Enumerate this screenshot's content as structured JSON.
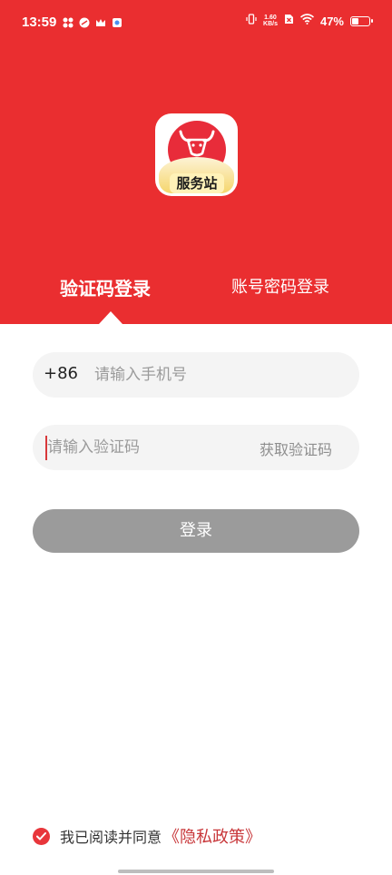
{
  "status_bar": {
    "time": "13:59",
    "net_speed_value": "1.60",
    "net_speed_unit": "KB/s",
    "battery": "47%",
    "battery_level": 0.47
  },
  "app": {
    "logo_text": "服务站"
  },
  "tabs": [
    {
      "label": "验证码登录",
      "active": true
    },
    {
      "label": "账号密码登录",
      "active": false
    }
  ],
  "form": {
    "country_code": "+86",
    "phone_placeholder": "请输入手机号",
    "code_placeholder": "请输入验证码",
    "get_code_label": "获取验证码",
    "login_label": "登录"
  },
  "agreement": {
    "text": "我已阅读并同意",
    "policy_link": "《隐私政策》",
    "checked": true
  },
  "colors": {
    "brand_red": "#ea2e30",
    "disabled_button": "#9b9b9b",
    "link": "#c8373a"
  }
}
